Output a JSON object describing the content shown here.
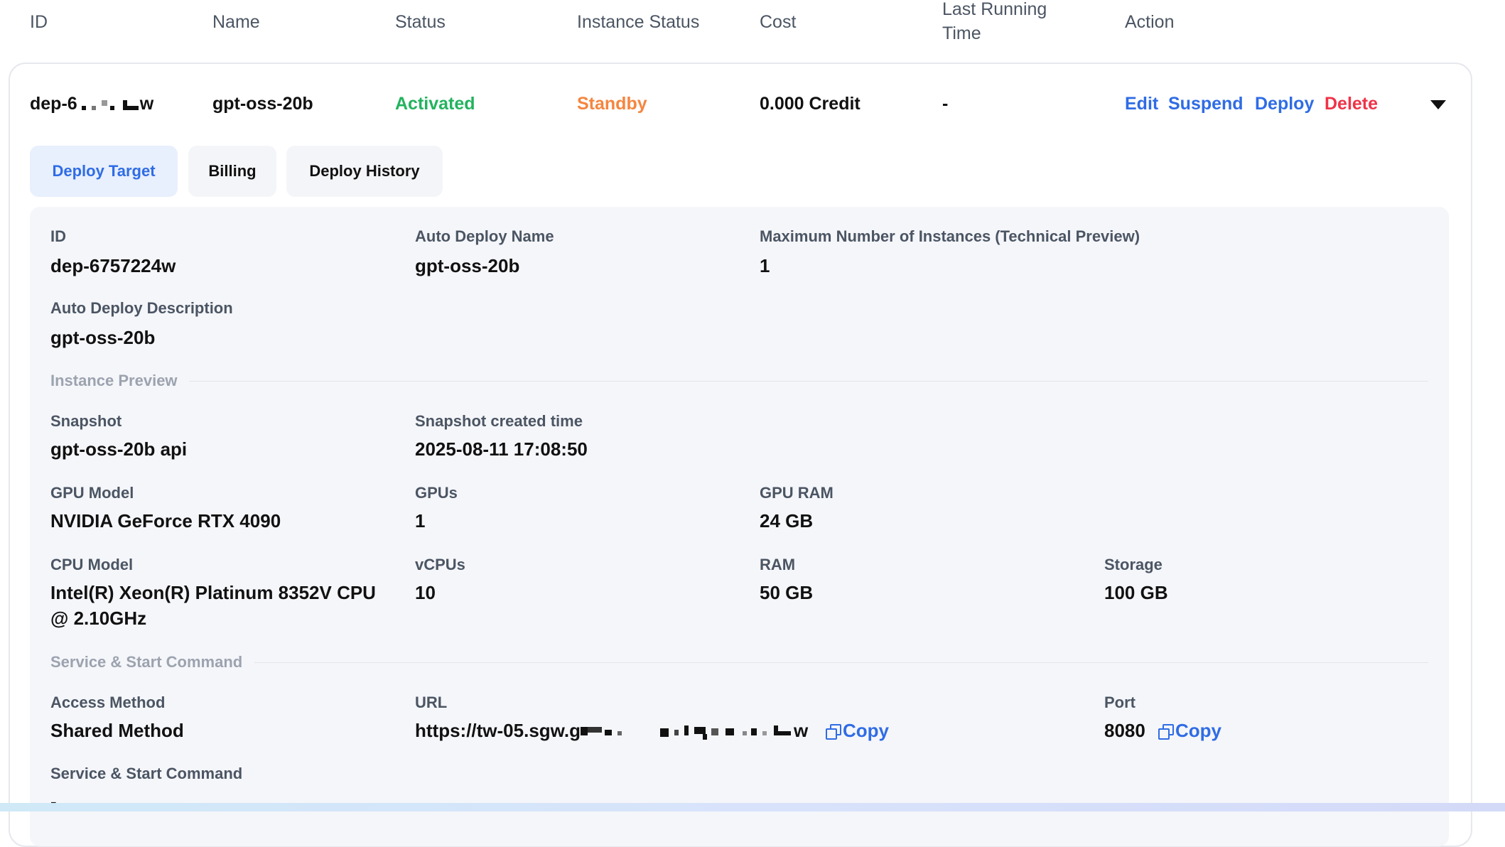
{
  "table_header": {
    "id": "ID",
    "name": "Name",
    "status": "Status",
    "instance_status": "Instance Status",
    "cost": "Cost",
    "last_running_time_line1": "Last Running",
    "last_running_time_line2": "Time",
    "action": "Action"
  },
  "row": {
    "id_prefix": "dep-6",
    "id_suffix": "w",
    "name": "gpt-oss-20b",
    "status": "Activated",
    "instance_status": "Standby",
    "cost": "0.000 Credit",
    "last_running_time": "-",
    "actions": {
      "edit": "Edit",
      "suspend": "Suspend",
      "deploy": "Deploy",
      "delete": "Delete"
    }
  },
  "tabs": [
    {
      "label": "Deploy Target",
      "active": true
    },
    {
      "label": "Billing",
      "active": false
    },
    {
      "label": "Deploy History",
      "active": false
    }
  ],
  "details": {
    "id_label": "ID",
    "id_value": "dep-6757224w",
    "auto_deploy_name_label": "Auto Deploy Name",
    "auto_deploy_name_value": "gpt-oss-20b",
    "max_instances_label": "Maximum Number of Instances (Technical Preview)",
    "max_instances_value": "1",
    "auto_deploy_desc_label": "Auto Deploy Description",
    "auto_deploy_desc_value": "gpt-oss-20b",
    "instance_preview_section": "Instance Preview",
    "snapshot_label": "Snapshot",
    "snapshot_value": "gpt-oss-20b api",
    "snapshot_created_label": "Snapshot created time",
    "snapshot_created_value": "2025-08-11 17:08:50",
    "gpu_model_label": "GPU Model",
    "gpu_model_value": "NVIDIA GeForce RTX 4090",
    "gpus_label": "GPUs",
    "gpus_value": "1",
    "gpu_ram_label": "GPU RAM",
    "gpu_ram_value": "24 GB",
    "cpu_model_label": "CPU Model",
    "cpu_model_value_line1": "Intel(R) Xeon(R) Platinum 8352V CPU",
    "cpu_model_value_line2": "@ 2.10GHz",
    "vcpus_label": "vCPUs",
    "vcpus_value": "10",
    "ram_label": "RAM",
    "ram_value": "50 GB",
    "storage_label": "Storage",
    "storage_value": "100 GB",
    "service_section": "Service & Start Command",
    "access_method_label": "Access Method",
    "access_method_value": "Shared Method",
    "url_label": "URL",
    "url_prefix": "https://tw-05.sgw.g",
    "url_suffix": "w",
    "copy_label": "Copy",
    "port_label": "Port",
    "port_value": "8080",
    "start_command_label": "Service & Start Command",
    "start_command_value": "-"
  },
  "colors": {
    "activated": "#22b35e",
    "standby": "#f5853f",
    "action_link": "#2f6ce5",
    "delete": "#ef3347"
  }
}
